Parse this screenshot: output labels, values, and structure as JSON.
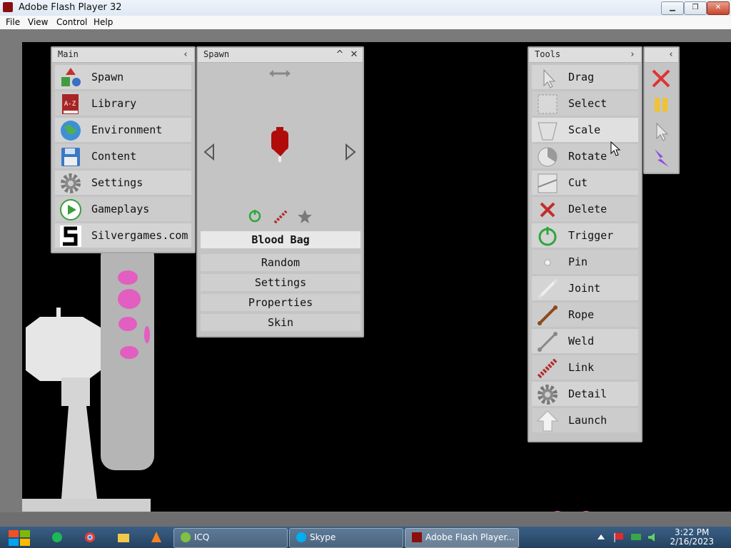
{
  "window": {
    "title": "Adobe Flash Player 32",
    "minimize": "▁",
    "maximize": "❐",
    "close": "✕"
  },
  "menu": [
    "File",
    "View",
    "Control",
    "Help"
  ],
  "main_panel": {
    "title": "Main",
    "collapse_icon": "‹",
    "items": [
      {
        "label": "Spawn",
        "icon": "shapes-icon"
      },
      {
        "label": "Library",
        "icon": "book-icon"
      },
      {
        "label": "Environment",
        "icon": "globe-icon"
      },
      {
        "label": "Content",
        "icon": "floppy-icon"
      },
      {
        "label": "Settings",
        "icon": "gear-icon"
      },
      {
        "label": "Gameplays",
        "icon": "play-icon"
      },
      {
        "label": "Silvergames.com",
        "icon": "silvergames-logo-icon"
      }
    ]
  },
  "spawn_panel": {
    "title": "Spawn",
    "collapse": "^",
    "close": "✕",
    "selected_item": "Blood Bag",
    "items": [
      "Random",
      "Settings",
      "Properties",
      "Skin"
    ]
  },
  "tools_panel": {
    "title": "Tools",
    "expand_icon": "›",
    "items": [
      {
        "label": "Drag",
        "icon": "cursor-icon"
      },
      {
        "label": "Select",
        "icon": "select-box-icon"
      },
      {
        "label": "Scale",
        "icon": "scale-icon"
      },
      {
        "label": "Rotate",
        "icon": "rotate-icon"
      },
      {
        "label": "Cut",
        "icon": "cut-icon"
      },
      {
        "label": "Delete",
        "icon": "delete-x-icon"
      },
      {
        "label": "Trigger",
        "icon": "power-icon"
      },
      {
        "label": "Pin",
        "icon": "pin-icon"
      },
      {
        "label": "Joint",
        "icon": "joint-icon"
      },
      {
        "label": "Rope",
        "icon": "rope-icon"
      },
      {
        "label": "Weld",
        "icon": "weld-icon"
      },
      {
        "label": "Link",
        "icon": "link-icon"
      },
      {
        "label": "Detail",
        "icon": "detail-gear-icon"
      },
      {
        "label": "Launch",
        "icon": "launch-arrow-icon"
      }
    ]
  },
  "quick_panel": {
    "collapse": "‹",
    "items": [
      "clear-x-icon",
      "pause-icon",
      "pointer-icon",
      "lightning-icon"
    ]
  },
  "taskbar": {
    "apps": [
      {
        "label": "ICQ"
      },
      {
        "label": "Skype"
      },
      {
        "label": "Adobe Flash Player..."
      }
    ],
    "time": "3:22 PM",
    "date": "2/16/2023"
  }
}
